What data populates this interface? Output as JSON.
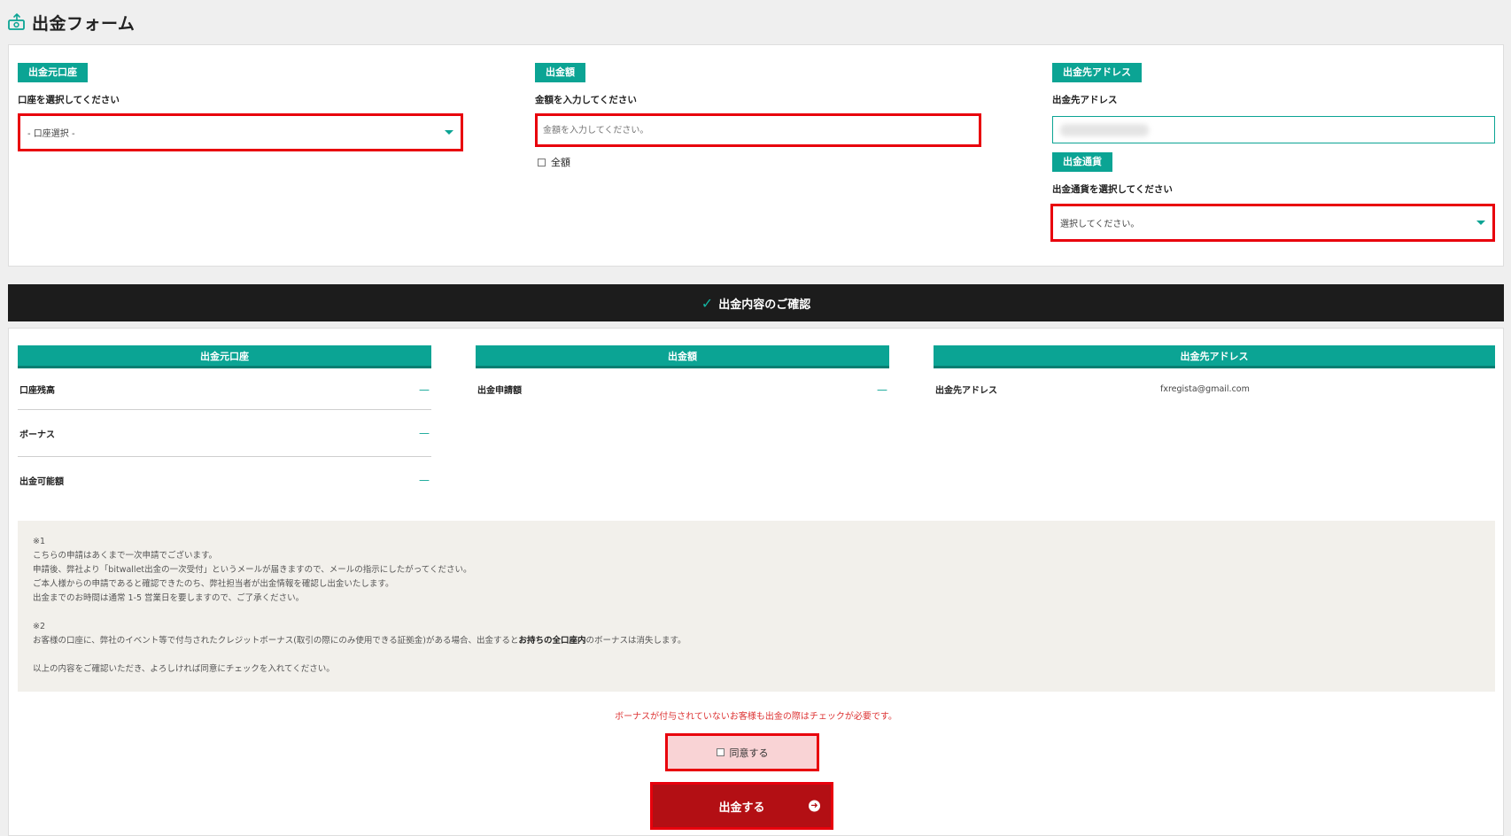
{
  "header": {
    "title": "出金フォーム",
    "icon": "money-transfer-icon"
  },
  "form": {
    "source_account": {
      "chip": "出金元口座",
      "label": "口座を選択してください",
      "selected": "- 口座選択 -"
    },
    "amount": {
      "chip": "出金額",
      "label": "金額を入力してください",
      "placeholder": "金額を入力してください。",
      "full_amount_label": "全額"
    },
    "destination": {
      "chip": "出金先アドレス",
      "label": "出金先アドレス",
      "value": ""
    },
    "currency": {
      "chip": "出金通貨",
      "label": "出金通貨を選択してください",
      "selected": "選択してください。"
    }
  },
  "confirm": {
    "title": "出金内容のご確認",
    "source": {
      "header": "出金元口座",
      "rows": [
        {
          "label": "口座残高",
          "value": "—"
        },
        {
          "label": "ボーナス",
          "value": "—"
        },
        {
          "label": "出金可能額",
          "value": "—"
        }
      ]
    },
    "amount": {
      "header": "出金額",
      "rows": [
        {
          "label": "出金申請額",
          "value": "—"
        }
      ]
    },
    "destination": {
      "header": "出金先アドレス",
      "rows": [
        {
          "label": "出金先アドレス",
          "value": "fxregista@gmail.com"
        }
      ]
    }
  },
  "notice": {
    "lines": [
      "※1",
      "こちらの申請はあくまで一次申請でございます。",
      "申請後、弊社より「bitwallet出金の一次受付」というメールが届きますので、メールの指示にしたがってください。",
      "ご本人様からの申請であると確認できたのち、弊社担当者が出金情報を確認し出金いたします。",
      "出金までのお時間は通常 1-5 営業日を要しますので、ご了承ください。",
      "",
      "※2",
      "お客様の口座に、弊社のイベント等で付与されたクレジットボーナス(取引の際にのみ使用できる証拠金)がある場合、出金すると",
      "お持ちの全口座内",
      "のボーナスは消失します。",
      "",
      "以上の内容をご確認いただき、よろしければ同意にチェックを入れてください。"
    ]
  },
  "warning": "ボーナスが付与されていないお客様も出金の際はチェックが必要です。",
  "agree_label": "同意する",
  "submit_label": "出金する",
  "colors": {
    "accent": "#0ba494",
    "highlight": "#e8000c",
    "submit": "#b30f14",
    "dark_bar": "#1c1c1c"
  }
}
